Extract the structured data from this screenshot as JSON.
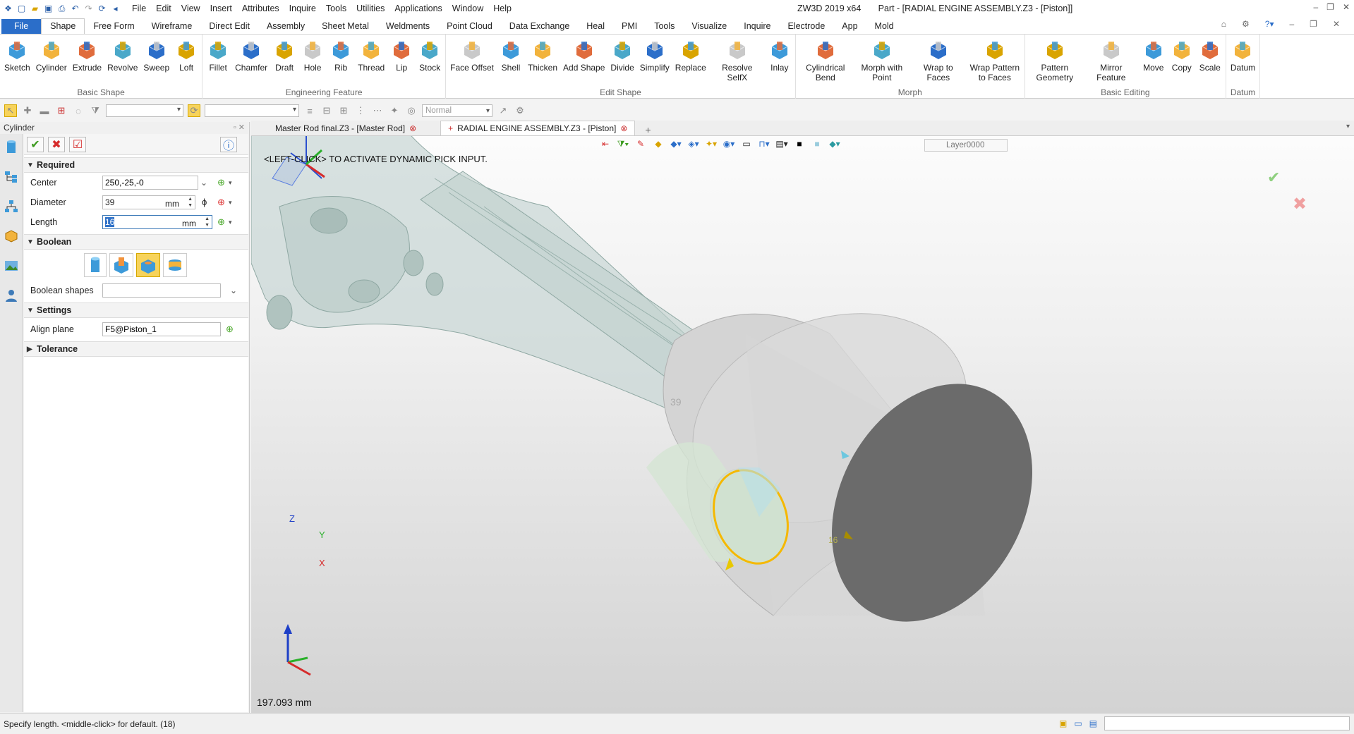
{
  "titlebar": {
    "app_title": "ZW3D 2019  x64",
    "doc_title": "Part - [RADIAL ENGINE ASSEMBLY.Z3 - [Piston]]",
    "menu": [
      "File",
      "Edit",
      "View",
      "Insert",
      "Attributes",
      "Inquire",
      "Tools",
      "Utilities",
      "Applications",
      "Window",
      "Help"
    ]
  },
  "ribbon_tabs": [
    "File",
    "Shape",
    "Free Form",
    "Wireframe",
    "Direct Edit",
    "Assembly",
    "Sheet Metal",
    "Weldments",
    "Point Cloud",
    "Data Exchange",
    "Heal",
    "PMI",
    "Tools",
    "Visualize",
    "Inquire",
    "Electrode",
    "App",
    "Mold"
  ],
  "ribbon_active_tab": "Shape",
  "ribbon_groups": [
    {
      "title": "Basic Shape",
      "buttons": [
        "Sketch",
        "Cylinder",
        "Extrude",
        "Revolve",
        "Sweep",
        "Loft"
      ]
    },
    {
      "title": "Engineering Feature",
      "buttons": [
        "Fillet",
        "Chamfer",
        "Draft",
        "Hole",
        "Rib",
        "Thread",
        "Lip",
        "Stock"
      ]
    },
    {
      "title": "Edit Shape",
      "buttons": [
        "Face Offset",
        "Shell",
        "Thicken",
        "Add Shape",
        "Divide",
        "Simplify",
        "Replace",
        "Resolve SelfX",
        "Inlay"
      ]
    },
    {
      "title": "Morph",
      "buttons": [
        "Cylindrical Bend",
        "Morph with Point",
        "Wrap to Faces",
        "Wrap Pattern to Faces"
      ]
    },
    {
      "title": "Basic Editing",
      "buttons": [
        "Pattern Geometry",
        "Mirror Feature",
        "Move",
        "Copy",
        "Scale"
      ]
    },
    {
      "title": "Datum",
      "buttons": [
        "Datum"
      ]
    }
  ],
  "toolbar2": {
    "render_mode": "Normal"
  },
  "panel": {
    "title": "Cylinder",
    "required_label": "Required",
    "center_label": "Center",
    "center_value": "250,-25,-0",
    "diameter_label": "Diameter",
    "diameter_value": "39",
    "diameter_unit": "mm",
    "length_label": "Length",
    "length_value": "16",
    "length_unit": "mm",
    "boolean_label": "Boolean",
    "boolean_shapes_label": "Boolean shapes",
    "settings_label": "Settings",
    "align_plane_label": "Align plane",
    "align_plane_value": "F5@Piston_1",
    "tolerance_label": "Tolerance"
  },
  "doc_tabs": [
    "Master Rod final.Z3 - [Master Rod]",
    "RADIAL ENGINE ASSEMBLY.Z3 - [Piston]"
  ],
  "viewport": {
    "layer": "Layer0000",
    "hint": "<LEFT-CLICK> TO ACTIVATE DYNAMIC PICK INPUT.",
    "dim_diameter": "39",
    "dim_length": "16",
    "distance": "197.093 mm",
    "axis_x": "X",
    "axis_y": "Y",
    "axis_z": "Z"
  },
  "status": {
    "prompt": "Specify length.  <middle-click> for default. (18)"
  },
  "colors": {
    "accent": "#2b6ec9",
    "ok_green": "#3c9a1e",
    "cancel_red": "#d62b2b",
    "highlight": "#f5b800"
  }
}
